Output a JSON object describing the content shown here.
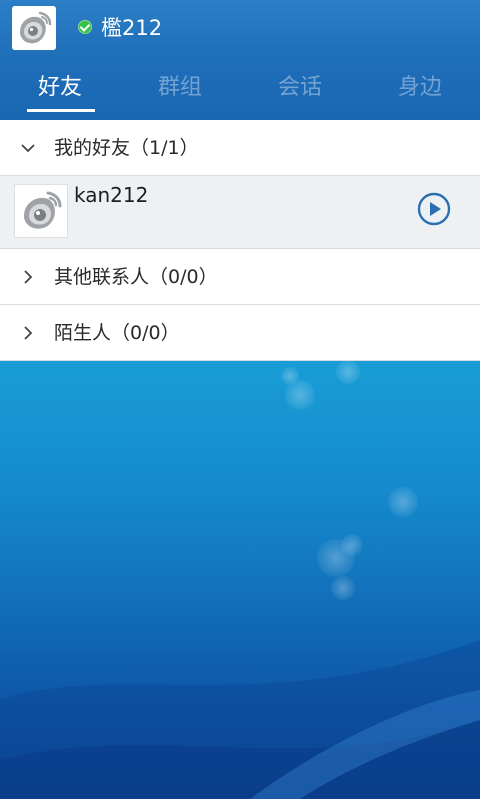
{
  "header": {
    "username": "檻212",
    "status": "online",
    "status_color": "#38c14c",
    "avatar_icon": "weibo-eye-icon"
  },
  "tabs": [
    {
      "label": "好友",
      "active": true
    },
    {
      "label": "群组",
      "active": false
    },
    {
      "label": "会话",
      "active": false
    },
    {
      "label": "身边",
      "active": false
    }
  ],
  "groups": [
    {
      "label": "我的好友（1/1）",
      "expanded": true
    },
    {
      "label": "其他联系人（0/0）",
      "expanded": false
    },
    {
      "label": "陌生人（0/0）",
      "expanded": false
    }
  ],
  "friends": [
    {
      "name": "kan212",
      "avatar_icon": "weibo-eye-icon",
      "action_icon": "play-circle-icon"
    }
  ],
  "colors": {
    "header": "#1f6fb9",
    "accent": "#2a6fb0",
    "background": "#1aa6da"
  }
}
